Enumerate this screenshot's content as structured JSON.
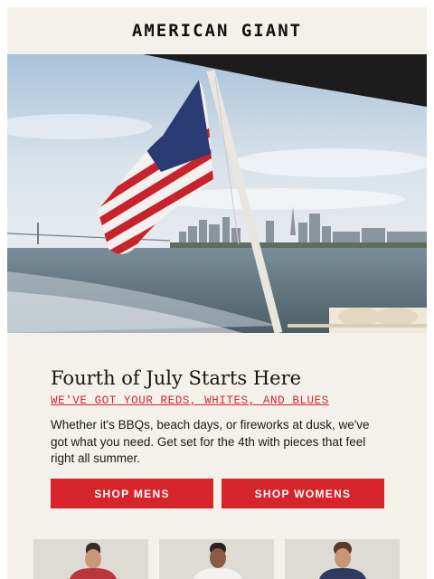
{
  "header": {
    "brand": "AMERICAN GIANT"
  },
  "hero": {
    "image": "american-flag-boat-skyline"
  },
  "promo": {
    "title": "Fourth of July Starts Here",
    "subtitle": "WE'VE GOT YOUR REDS, WHITES, AND BLUES",
    "body": "Whether it's BBQs, beach days, or fireworks at dusk, we've got what you need. Get set for the 4th with pieces that feel right all summer."
  },
  "buttons": {
    "shop_mens": "SHOP MENS",
    "shop_womens": "SHOP WOMENS"
  },
  "colors": {
    "background": "#f4f1eb",
    "accent_red": "#d7232b",
    "text": "#161616"
  },
  "products": [
    {
      "image": "model-red-tee"
    },
    {
      "image": "model-white-tee"
    },
    {
      "image": "model-navy-tee"
    }
  ]
}
